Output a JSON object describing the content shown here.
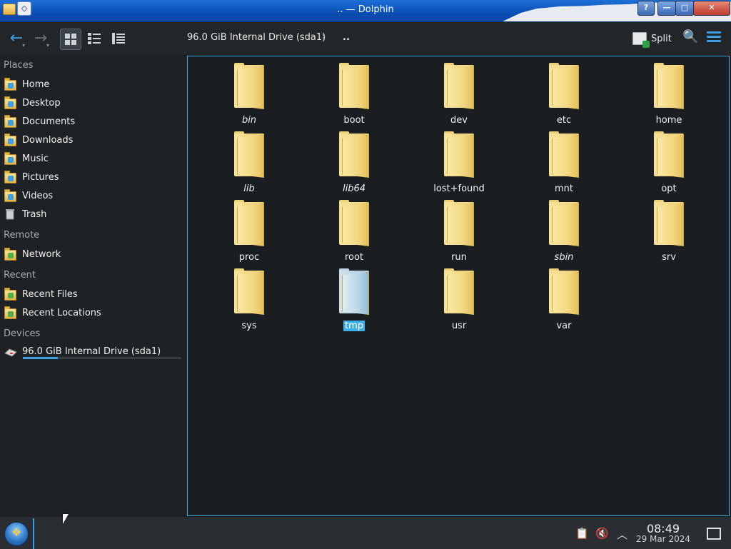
{
  "window": {
    "title": ".. — Dolphin",
    "controls": {
      "help": "?",
      "minimize": "—",
      "maximize": "□",
      "close": "✕"
    }
  },
  "toolbar": {
    "back_icon": "←",
    "forward_icon": "→",
    "location": "96.0 GiB Internal Drive (sda1)",
    "location_separator": "›",
    "current_folder": "..",
    "split_label": "Split",
    "search_icon": "🔍"
  },
  "sidebar": {
    "sections": {
      "places": "Places",
      "remote": "Remote",
      "recent": "Recent",
      "devices": "Devices"
    },
    "places": [
      {
        "label": "Home",
        "icon": "home-folder-icon"
      },
      {
        "label": "Desktop",
        "icon": "desktop-folder-icon"
      },
      {
        "label": "Documents",
        "icon": "documents-folder-icon"
      },
      {
        "label": "Downloads",
        "icon": "downloads-folder-icon"
      },
      {
        "label": "Music",
        "icon": "music-folder-icon"
      },
      {
        "label": "Pictures",
        "icon": "pictures-folder-icon"
      },
      {
        "label": "Videos",
        "icon": "videos-folder-icon"
      },
      {
        "label": "Trash",
        "icon": "trash-icon"
      }
    ],
    "remote": [
      {
        "label": "Network",
        "icon": "network-icon"
      }
    ],
    "recent": [
      {
        "label": "Recent Files",
        "icon": "recent-files-icon"
      },
      {
        "label": "Recent Locations",
        "icon": "recent-locations-icon"
      }
    ],
    "devices": [
      {
        "label": "96.0 GiB Internal Drive (sda1)",
        "icon": "drive-icon",
        "usage_fraction": 0.22
      }
    ]
  },
  "files": [
    {
      "name": "bin",
      "italic": true
    },
    {
      "name": "boot",
      "italic": false
    },
    {
      "name": "dev",
      "italic": false
    },
    {
      "name": "etc",
      "italic": false
    },
    {
      "name": "home",
      "italic": false
    },
    {
      "name": "lib",
      "italic": true
    },
    {
      "name": "lib64",
      "italic": true
    },
    {
      "name": "lost+found",
      "italic": false
    },
    {
      "name": "mnt",
      "italic": false
    },
    {
      "name": "opt",
      "italic": false
    },
    {
      "name": "proc",
      "italic": false
    },
    {
      "name": "root",
      "italic": false
    },
    {
      "name": "run",
      "italic": false
    },
    {
      "name": "sbin",
      "italic": true
    },
    {
      "name": "srv",
      "italic": false
    },
    {
      "name": "sys",
      "italic": false
    },
    {
      "name": "tmp",
      "italic": false,
      "selected": true
    },
    {
      "name": "usr",
      "italic": false
    },
    {
      "name": "var",
      "italic": false
    }
  ],
  "taskbar": {
    "time": "08:49",
    "date": "29 Mar 2024",
    "tray_icons": [
      "clipboard-icon",
      "volume-muted-icon",
      "chevron-up-icon"
    ]
  },
  "colors": {
    "accent": "#3daee9",
    "titlebar": "#0a4fb4",
    "background": "#1b1e21",
    "folder": "#f2d780",
    "selection": "#3daee9"
  }
}
